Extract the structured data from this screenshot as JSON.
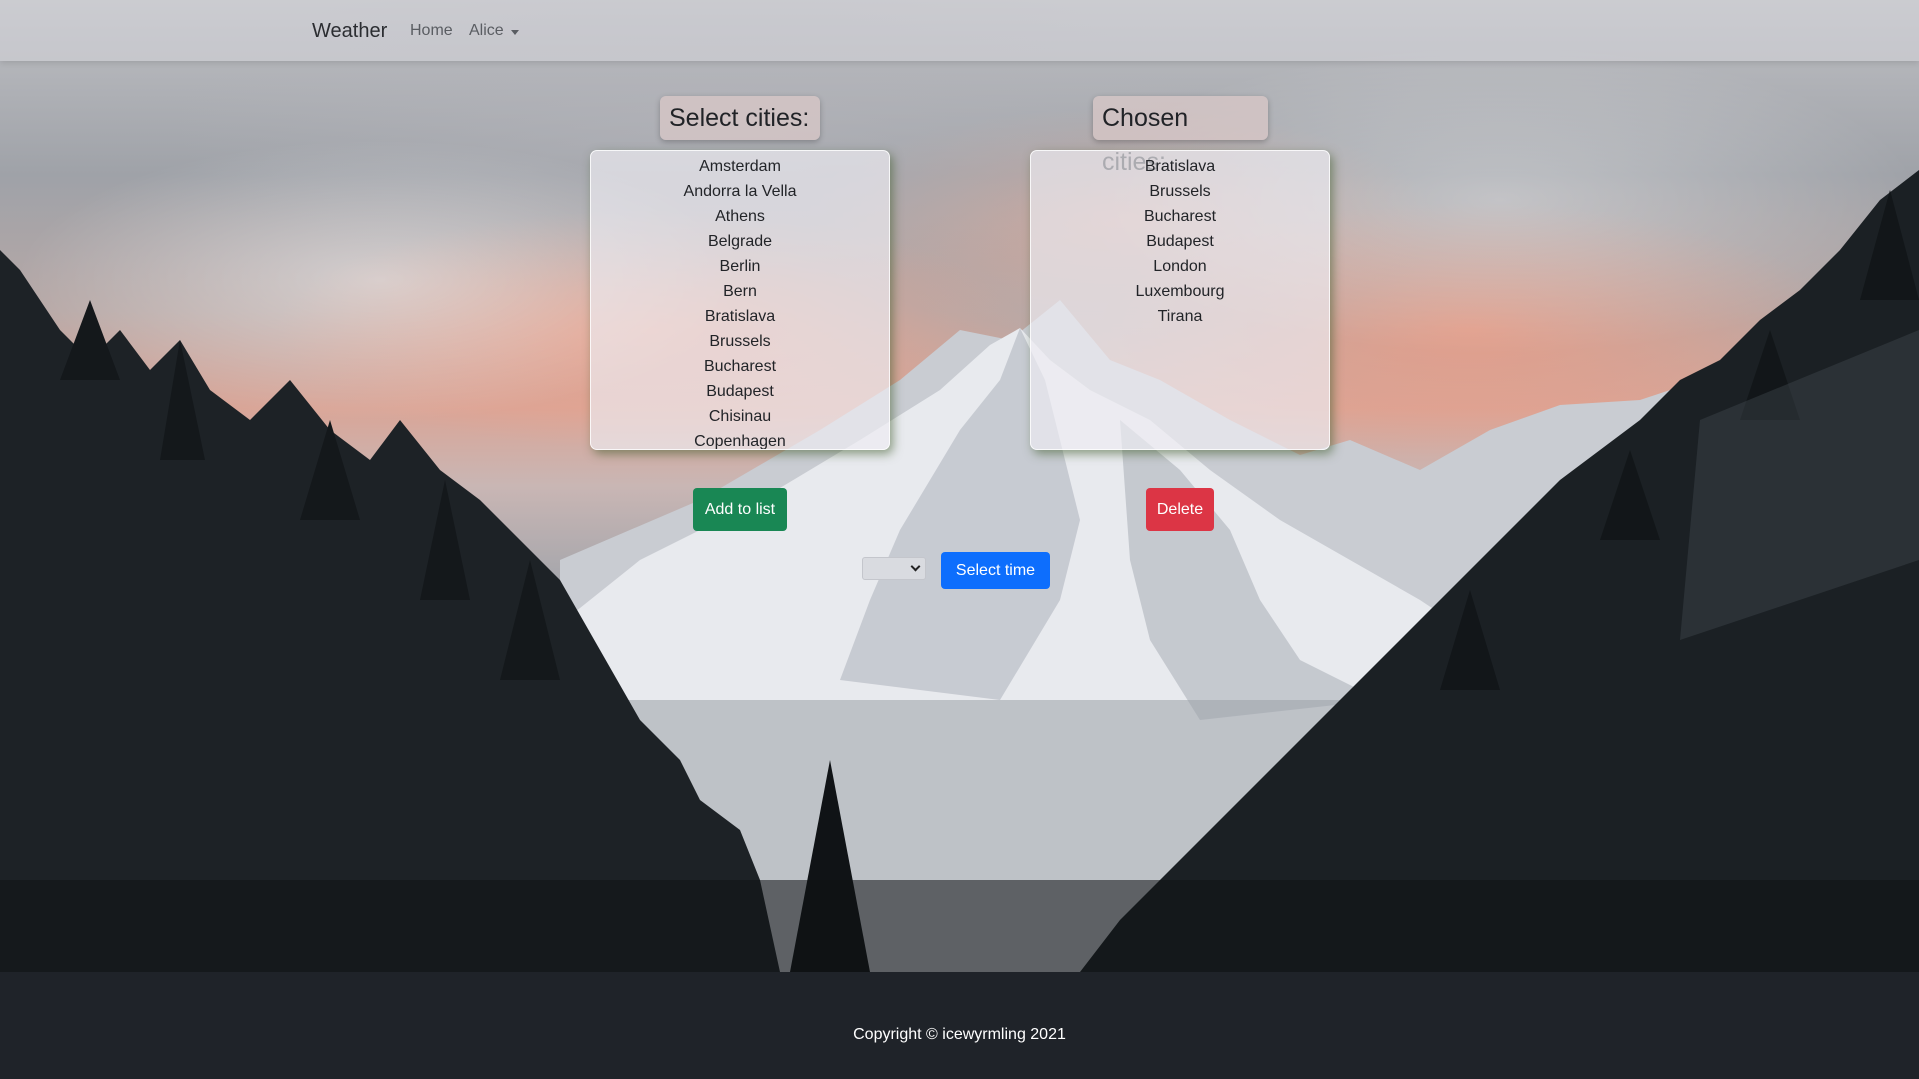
{
  "navbar": {
    "brand": "Weather",
    "links": [
      {
        "label": "Home"
      },
      {
        "label": "Alice"
      }
    ]
  },
  "select_panel": {
    "heading": "Select cities:",
    "cities": [
      "Amsterdam",
      "Andorra la Vella",
      "Athens",
      "Belgrade",
      "Berlin",
      "Bern",
      "Bratislava",
      "Brussels",
      "Bucharest",
      "Budapest",
      "Chisinau",
      "Copenhagen"
    ],
    "button_label": "Add to list"
  },
  "chosen_panel": {
    "heading": "Chosen cities:",
    "cities": [
      "Bratislava",
      "Brussels",
      "Bucharest",
      "Budapest",
      "London",
      "Luxembourg",
      "Tirana"
    ],
    "button_label": "Delete"
  },
  "time_control": {
    "selected_value": "",
    "button_label": "Select time"
  },
  "footer": {
    "copyright": "Copyright © icewyrmling 2021"
  },
  "colors": {
    "add_button": "#198754",
    "delete_button": "#dc3545",
    "select_time_button": "#0d6efd",
    "footer_bg": "#1f2329"
  },
  "icons": {
    "user_menu": "caret-down-icon",
    "time_select": "chevron-down-icon"
  }
}
